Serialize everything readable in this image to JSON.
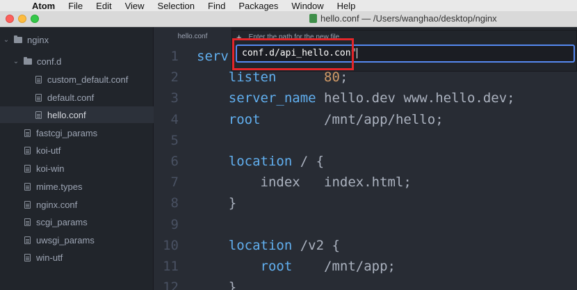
{
  "menubar": {
    "apple_glyph": "",
    "items": [
      "Atom",
      "File",
      "Edit",
      "View",
      "Selection",
      "Find",
      "Packages",
      "Window",
      "Help"
    ]
  },
  "window": {
    "title": "hello.conf — /Users/wanghao/desktop/nginx"
  },
  "sidebar": {
    "root": "nginx",
    "subfolder": "conf.d",
    "subfolder_files": [
      "custom_default.conf",
      "default.conf",
      "hello.conf"
    ],
    "files": [
      "fastcgi_params",
      "koi-utf",
      "koi-win",
      "mime.types",
      "nginx.conf",
      "scgi_params",
      "uwsgi_params",
      "win-utf"
    ]
  },
  "editor": {
    "tab": "hello.conf",
    "lines": [
      {
        "n": "1",
        "parts": [
          [
            "kw",
            "serv"
          ]
        ]
      },
      {
        "n": "2",
        "parts": [
          [
            "pl",
            "    "
          ],
          [
            "kw",
            "listen"
          ],
          [
            "pl",
            "      "
          ],
          [
            "num",
            "80"
          ],
          [
            "pl",
            ";"
          ]
        ]
      },
      {
        "n": "3",
        "parts": [
          [
            "pl",
            "    "
          ],
          [
            "kw",
            "server_name"
          ],
          [
            "pl",
            " hello.dev www.hello.dev;"
          ]
        ]
      },
      {
        "n": "4",
        "parts": [
          [
            "pl",
            "    "
          ],
          [
            "kw",
            "root"
          ],
          [
            "pl",
            "        /mnt/app/hello;"
          ]
        ]
      },
      {
        "n": "5",
        "parts": []
      },
      {
        "n": "6",
        "parts": [
          [
            "pl",
            "    "
          ],
          [
            "kw",
            "location"
          ],
          [
            "pl",
            " / {"
          ]
        ]
      },
      {
        "n": "7",
        "parts": [
          [
            "pl",
            "        index   index.html;"
          ]
        ]
      },
      {
        "n": "8",
        "parts": [
          [
            "pl",
            "    }"
          ]
        ]
      },
      {
        "n": "9",
        "parts": []
      },
      {
        "n": "10",
        "parts": [
          [
            "pl",
            "    "
          ],
          [
            "kw",
            "location"
          ],
          [
            "pl",
            " /v2 {"
          ]
        ]
      },
      {
        "n": "11",
        "parts": [
          [
            "pl",
            "        "
          ],
          [
            "kw",
            "root"
          ],
          [
            "pl",
            "    /mnt/app;"
          ]
        ]
      },
      {
        "n": "12",
        "parts": [
          [
            "pl",
            "    }"
          ]
        ]
      }
    ]
  },
  "new_file_dialog": {
    "label": "Enter the path for the new file.",
    "value": "conf.d/api_hello.conf"
  },
  "colors": {
    "highlight_box": "#e4262a",
    "input_focus": "#568af2",
    "keyword": "#61afef"
  }
}
